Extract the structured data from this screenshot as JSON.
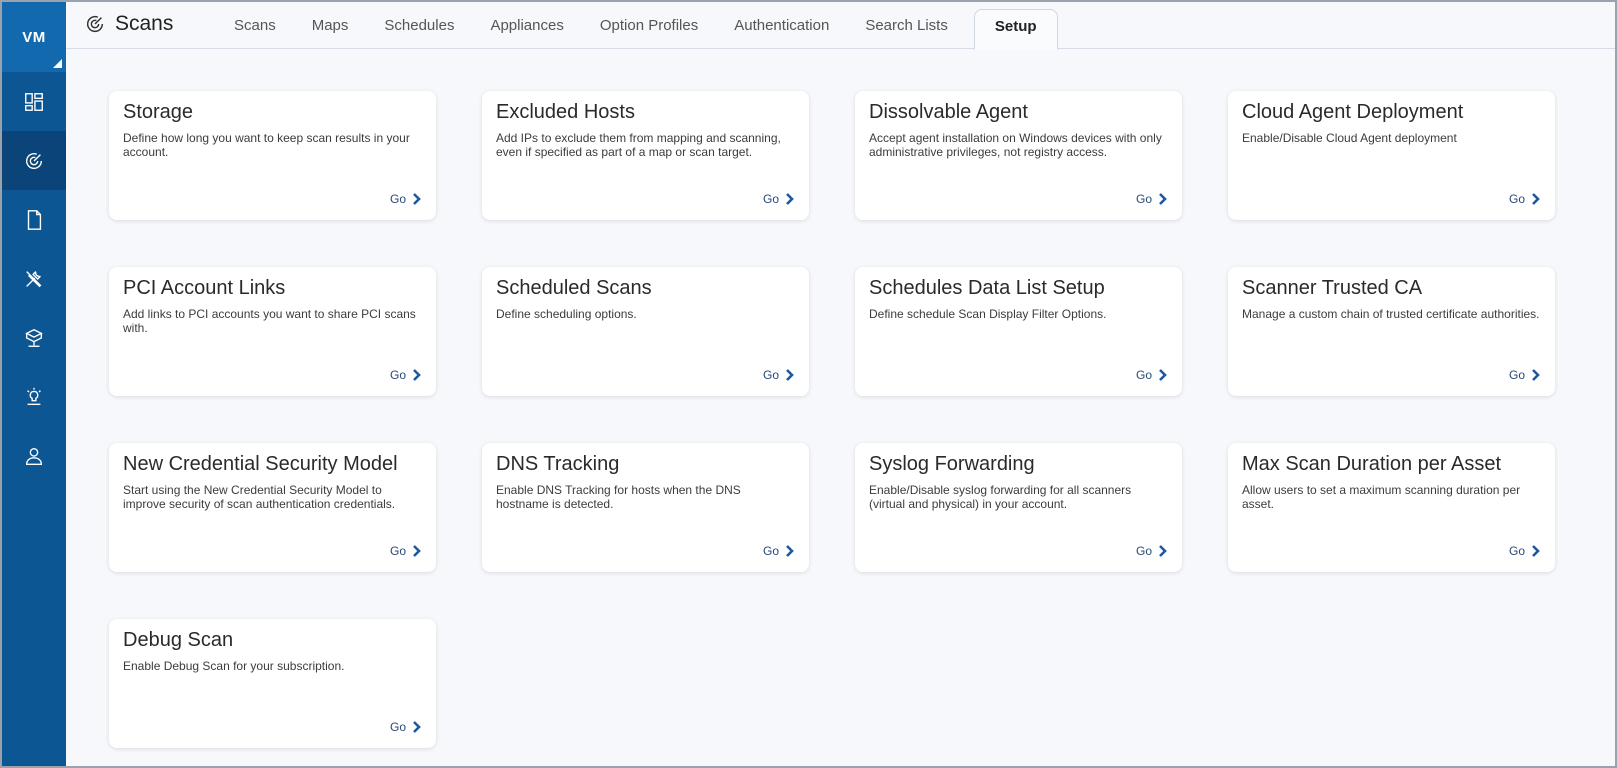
{
  "brand": {
    "label": "VM"
  },
  "sidebar": {
    "items": [
      {
        "name": "dashboard-icon",
        "active": false
      },
      {
        "name": "scans-radar-icon",
        "active": true
      },
      {
        "name": "reports-document-icon",
        "active": false
      },
      {
        "name": "tools-icon",
        "active": false
      },
      {
        "name": "assets-network-icon",
        "active": false
      },
      {
        "name": "knowledgebase-bulb-icon",
        "active": false
      },
      {
        "name": "user-icon",
        "active": false
      }
    ]
  },
  "header": {
    "title": "Scans",
    "tabs": [
      {
        "label": "Scans"
      },
      {
        "label": "Maps"
      },
      {
        "label": "Schedules"
      },
      {
        "label": "Appliances"
      },
      {
        "label": "Option Profiles"
      },
      {
        "label": "Authentication"
      },
      {
        "label": "Search Lists"
      },
      {
        "label": "Setup"
      }
    ],
    "active_tab": "Setup"
  },
  "go_label": "Go",
  "cards": [
    {
      "title": "Storage",
      "desc": "Define how long you want to keep scan results in your account."
    },
    {
      "title": "Excluded Hosts",
      "desc": "Add IPs to exclude them from mapping and scanning, even if specified as part of a map or scan target."
    },
    {
      "title": "Dissolvable Agent",
      "desc": "Accept agent installation on Windows devices with only administrative privileges, not registry access."
    },
    {
      "title": "Cloud Agent Deployment",
      "desc": "Enable/Disable Cloud Agent deployment"
    },
    {
      "title": "PCI Account Links",
      "desc": "Add links to PCI accounts you want to share PCI scans with."
    },
    {
      "title": "Scheduled Scans",
      "desc": "Define scheduling options."
    },
    {
      "title": "Schedules Data List Setup",
      "desc": "Define schedule Scan Display Filter Options."
    },
    {
      "title": "Scanner Trusted CA",
      "desc": "Manage a custom chain of trusted certificate authorities."
    },
    {
      "title": "New Credential Security Model",
      "desc": "Start using the New Credential Security Model to improve security of scan authentication credentials."
    },
    {
      "title": "DNS Tracking",
      "desc": "Enable DNS Tracking for hosts when the DNS hostname is detected."
    },
    {
      "title": "Syslog Forwarding",
      "desc": "Enable/Disable syslog forwarding for all scanners (virtual and physical) in your account."
    },
    {
      "title": "Max Scan Duration per Asset",
      "desc": "Allow users to set a maximum scanning duration per asset."
    },
    {
      "title": "Debug Scan",
      "desc": "Enable Debug Scan for your subscription."
    }
  ]
}
